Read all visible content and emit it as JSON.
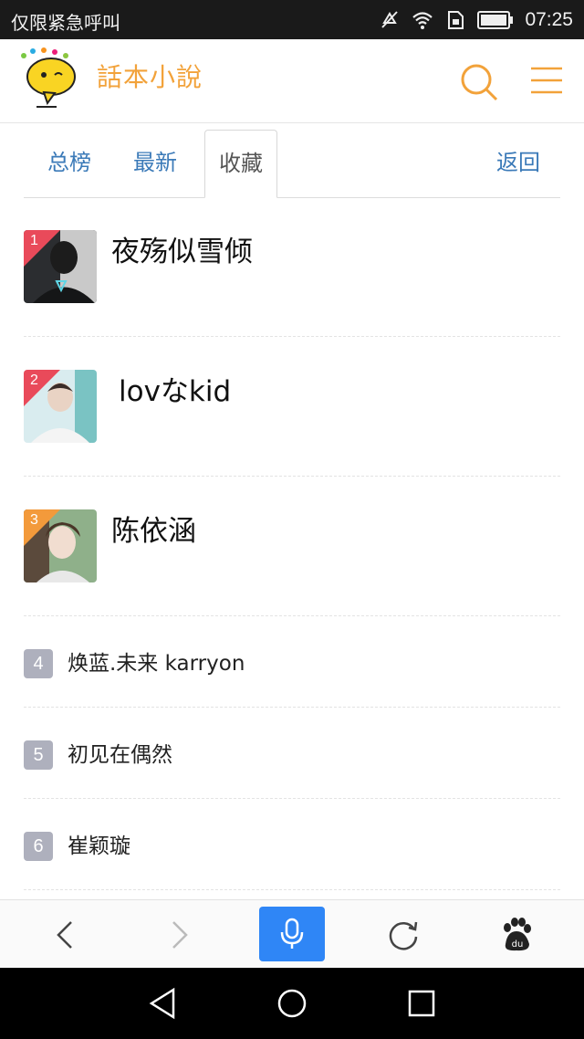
{
  "status_bar": {
    "carrier": "仅限紧急呼叫",
    "time": "07:25",
    "icons": [
      "mute-icon",
      "wifi-icon",
      "sim-icon",
      "battery-icon"
    ]
  },
  "header": {
    "logo_text": "話本小說",
    "search_icon": "search-icon",
    "menu_icon": "menu-icon",
    "accent_color": "#f2a23a"
  },
  "tabs": [
    {
      "label": "总榜",
      "active": false
    },
    {
      "label": "最新",
      "active": false
    },
    {
      "label": "收藏",
      "active": true
    }
  ],
  "back_label": "返回",
  "top_rank": [
    {
      "rank": "1",
      "name": "夜殇似雪倾",
      "badge_color": "#e94a5a"
    },
    {
      "rank": "2",
      "name": "lovなkid",
      "badge_color": "#e94a5a"
    },
    {
      "rank": "3",
      "name": "陈依涵",
      "badge_color": "#f39a3b"
    }
  ],
  "rest_rank": [
    {
      "rank": "4",
      "name": "焕蓝.未来 karryon"
    },
    {
      "rank": "5",
      "name": "初见在偶然"
    },
    {
      "rank": "6",
      "name": "崔颖璇"
    }
  ],
  "toolbar": {
    "icons": [
      "back-arrow-icon",
      "forward-arrow-icon",
      "microphone-icon",
      "refresh-icon",
      "baidu-paw-icon"
    ],
    "voice_color": "#2f86f6"
  },
  "android_nav": {
    "icons": [
      "nav-back-icon",
      "nav-home-icon",
      "nav-recent-icon"
    ]
  }
}
